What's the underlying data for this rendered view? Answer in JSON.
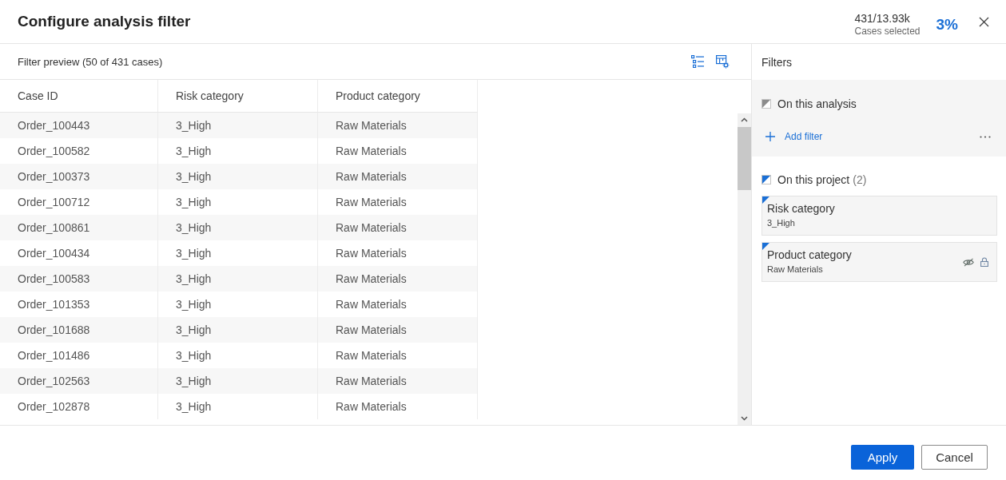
{
  "dialog": {
    "title": "Configure analysis filter",
    "selection": {
      "count": "431/13.93k",
      "label": "Cases selected",
      "percent": "3%"
    }
  },
  "preview": {
    "title": "Filter preview (50 of 431 cases)"
  },
  "table": {
    "columns": [
      "Case ID",
      "Risk category",
      "Product category"
    ],
    "rows": [
      [
        "Order_100443",
        "3_High",
        "Raw Materials"
      ],
      [
        "Order_100582",
        "3_High",
        "Raw Materials"
      ],
      [
        "Order_100373",
        "3_High",
        "Raw Materials"
      ],
      [
        "Order_100712",
        "3_High",
        "Raw Materials"
      ],
      [
        "Order_100861",
        "3_High",
        "Raw Materials"
      ],
      [
        "Order_100434",
        "3_High",
        "Raw Materials"
      ],
      [
        "Order_100583",
        "3_High",
        "Raw Materials"
      ],
      [
        "Order_101353",
        "3_High",
        "Raw Materials"
      ],
      [
        "Order_101688",
        "3_High",
        "Raw Materials"
      ],
      [
        "Order_101486",
        "3_High",
        "Raw Materials"
      ],
      [
        "Order_102563",
        "3_High",
        "Raw Materials"
      ],
      [
        "Order_102878",
        "3_High",
        "Raw Materials"
      ]
    ]
  },
  "filters": {
    "title": "Filters",
    "sections": [
      {
        "kind": "analysis",
        "label": "On this analysis",
        "color": "#8c8c8c",
        "action": "Add filter"
      },
      {
        "kind": "project",
        "label": "On this project",
        "count": "(2)",
        "color": "#1a6fd6",
        "items": [
          {
            "name": "Risk category",
            "value": "3_High",
            "hidden": false,
            "locked": false
          },
          {
            "name": "Product category",
            "value": "Raw Materials",
            "hidden": true,
            "locked": true
          }
        ]
      }
    ]
  },
  "buttons": [
    {
      "label": "Apply",
      "kind": "primary"
    },
    {
      "label": "Cancel",
      "kind": "secondary"
    }
  ]
}
